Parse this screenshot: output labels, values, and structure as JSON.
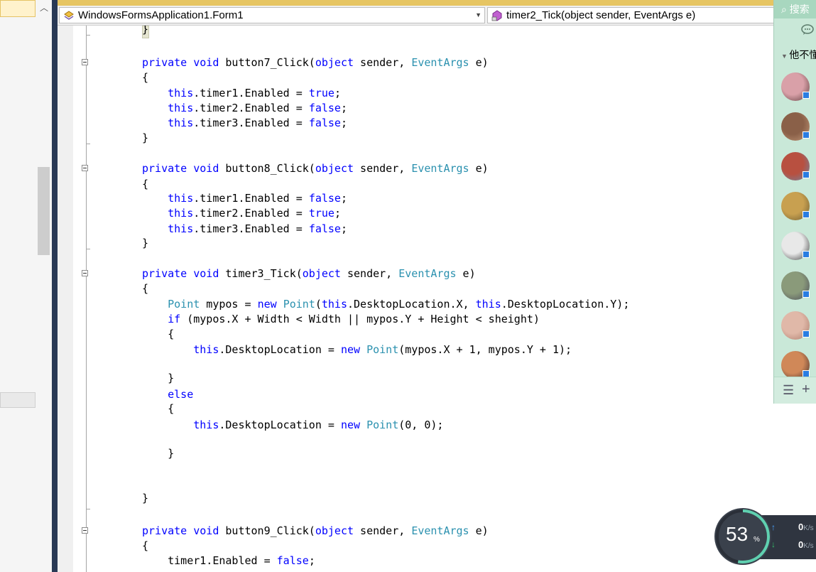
{
  "navigation": {
    "class_combo": "WindowsFormsApplication1.Form1",
    "member_combo": "timer2_Tick(object sender, EventArgs e)"
  },
  "code_lines": [
    [
      {
        "t": "}",
        "c": ""
      }
    ],
    [
      {
        "t": "private void ",
        "c": "kw"
      },
      {
        "t": "button7_Click(",
        "c": ""
      },
      {
        "t": "object",
        "c": "kw"
      },
      {
        "t": " sender, ",
        "c": ""
      },
      {
        "t": "EventArgs",
        "c": "ty"
      },
      {
        "t": " e)",
        "c": ""
      }
    ],
    [
      {
        "t": "{",
        "c": ""
      }
    ],
    [
      {
        "t": "    ",
        "c": ""
      },
      {
        "t": "this",
        "c": "kw"
      },
      {
        "t": ".timer1.Enabled = ",
        "c": ""
      },
      {
        "t": "true",
        "c": "kw"
      },
      {
        "t": ";",
        "c": ""
      }
    ],
    [
      {
        "t": "    ",
        "c": ""
      },
      {
        "t": "this",
        "c": "kw"
      },
      {
        "t": ".timer2.Enabled = ",
        "c": ""
      },
      {
        "t": "false",
        "c": "kw"
      },
      {
        "t": ";",
        "c": ""
      }
    ],
    [
      {
        "t": "    ",
        "c": ""
      },
      {
        "t": "this",
        "c": "kw"
      },
      {
        "t": ".timer3.Enabled = ",
        "c": ""
      },
      {
        "t": "false",
        "c": "kw"
      },
      {
        "t": ";",
        "c": ""
      }
    ],
    [
      {
        "t": "}",
        "c": ""
      }
    ],
    [
      {
        "t": "private void ",
        "c": "kw"
      },
      {
        "t": "button8_Click(",
        "c": ""
      },
      {
        "t": "object",
        "c": "kw"
      },
      {
        "t": " sender, ",
        "c": ""
      },
      {
        "t": "EventArgs",
        "c": "ty"
      },
      {
        "t": " e)",
        "c": ""
      }
    ],
    [
      {
        "t": "{",
        "c": ""
      }
    ],
    [
      {
        "t": "    ",
        "c": ""
      },
      {
        "t": "this",
        "c": "kw"
      },
      {
        "t": ".timer1.Enabled = ",
        "c": ""
      },
      {
        "t": "false",
        "c": "kw"
      },
      {
        "t": ";",
        "c": ""
      }
    ],
    [
      {
        "t": "    ",
        "c": ""
      },
      {
        "t": "this",
        "c": "kw"
      },
      {
        "t": ".timer2.Enabled = ",
        "c": ""
      },
      {
        "t": "true",
        "c": "kw"
      },
      {
        "t": ";",
        "c": ""
      }
    ],
    [
      {
        "t": "    ",
        "c": ""
      },
      {
        "t": "this",
        "c": "kw"
      },
      {
        "t": ".timer3.Enabled = ",
        "c": ""
      },
      {
        "t": "false",
        "c": "kw"
      },
      {
        "t": ";",
        "c": ""
      }
    ],
    [
      {
        "t": "}",
        "c": ""
      }
    ],
    [
      {
        "t": "private void ",
        "c": "kw"
      },
      {
        "t": "timer3_Tick(",
        "c": ""
      },
      {
        "t": "object",
        "c": "kw"
      },
      {
        "t": " sender, ",
        "c": ""
      },
      {
        "t": "EventArgs",
        "c": "ty"
      },
      {
        "t": " e)",
        "c": ""
      }
    ],
    [
      {
        "t": "{",
        "c": ""
      }
    ],
    [
      {
        "t": "    ",
        "c": ""
      },
      {
        "t": "Point",
        "c": "ty"
      },
      {
        "t": " mypos = ",
        "c": ""
      },
      {
        "t": "new ",
        "c": "kw"
      },
      {
        "t": "Point",
        "c": "ty"
      },
      {
        "t": "(",
        "c": ""
      },
      {
        "t": "this",
        "c": "kw"
      },
      {
        "t": ".DesktopLocation.X, ",
        "c": ""
      },
      {
        "t": "this",
        "c": "kw"
      },
      {
        "t": ".DesktopLocation.Y);",
        "c": ""
      }
    ],
    [
      {
        "t": "    ",
        "c": ""
      },
      {
        "t": "if",
        "c": "kw"
      },
      {
        "t": " (mypos.X + Width < Width || mypos.Y + Height < sheight)",
        "c": ""
      }
    ],
    [
      {
        "t": "    {",
        "c": ""
      }
    ],
    [
      {
        "t": "        ",
        "c": ""
      },
      {
        "t": "this",
        "c": "kw"
      },
      {
        "t": ".DesktopLocation = ",
        "c": ""
      },
      {
        "t": "new ",
        "c": "kw"
      },
      {
        "t": "Point",
        "c": "ty"
      },
      {
        "t": "(mypos.X + 1, mypos.Y + 1);",
        "c": ""
      }
    ],
    [
      {
        "t": "    }",
        "c": ""
      }
    ],
    [
      {
        "t": "    ",
        "c": ""
      },
      {
        "t": "else",
        "c": "kw"
      }
    ],
    [
      {
        "t": "    {",
        "c": ""
      }
    ],
    [
      {
        "t": "        ",
        "c": ""
      },
      {
        "t": "this",
        "c": "kw"
      },
      {
        "t": ".DesktopLocation = ",
        "c": ""
      },
      {
        "t": "new ",
        "c": "kw"
      },
      {
        "t": "Point",
        "c": "ty"
      },
      {
        "t": "(0, 0);",
        "c": ""
      }
    ],
    [
      {
        "t": "    }",
        "c": ""
      }
    ],
    [
      {
        "t": "}",
        "c": ""
      }
    ],
    [
      {
        "t": "private void ",
        "c": "kw"
      },
      {
        "t": "button9_Click(",
        "c": ""
      },
      {
        "t": "object",
        "c": "kw"
      },
      {
        "t": " sender, ",
        "c": ""
      },
      {
        "t": "EventArgs",
        "c": "ty"
      },
      {
        "t": " e)",
        "c": ""
      }
    ],
    [
      {
        "t": "{",
        "c": ""
      }
    ],
    [
      {
        "t": "    timer1.Enabled = ",
        "c": ""
      },
      {
        "t": "false",
        "c": "kw"
      },
      {
        "t": ";",
        "c": ""
      }
    ]
  ],
  "colors": {
    "keyword": "#0000ff",
    "type": "#2b91af",
    "accent": "#e6c563",
    "qq_panel": "#c9e8d8"
  },
  "qq": {
    "search_label": "搜索",
    "group_label": "他不懂",
    "chat_icon": "chat-bubble-icon",
    "menu_icon": "☰",
    "add_icon": "+"
  },
  "speed": {
    "percent": "53",
    "percent_unit": "%",
    "upload": "0",
    "download": "0",
    "unit": "K/s"
  }
}
